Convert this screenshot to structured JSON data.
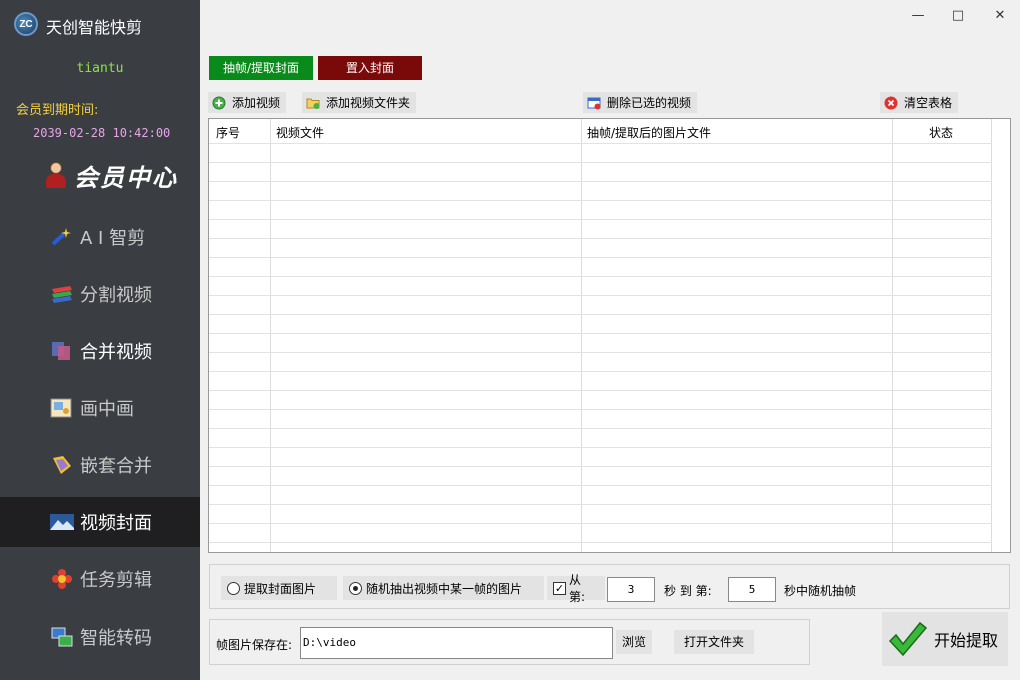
{
  "app": {
    "title": "天创智能快剪",
    "logo_text": "ZC"
  },
  "account": {
    "username": "tiantu",
    "expire_label": "会员到期时间:",
    "expire_value": "2039-02-28 10:42:00",
    "member_center": "会员中心"
  },
  "nav": {
    "ai": "A I 智剪",
    "split": "分割视频",
    "merge": "合并视频",
    "pip": "画中画",
    "nest": "嵌套合并",
    "cover": "视频封面",
    "task": "任务剪辑",
    "transcode": "智能转码"
  },
  "window": {
    "minimize": "—",
    "maximize": "□",
    "close": "✕"
  },
  "tabs": {
    "extract": "抽帧/提取封面",
    "insert": "置入封面"
  },
  "toolbar": {
    "add_video": "添加视频",
    "add_folder": "添加视频文件夹",
    "delete_selected": "删除已选的视频",
    "clear_table": "清空表格"
  },
  "table": {
    "columns": [
      "序号",
      "视频文件",
      "抽帧/提取后的图片文件",
      "状态"
    ]
  },
  "options": {
    "extract_cover": "提取封面图片",
    "random_frame": "随机抽出视频中某一帧的图片",
    "random_frame_selected": true,
    "range_checked": true,
    "from_label": "从第:",
    "from_value": "3",
    "sec_to": "秒 到 第:",
    "to_value": "5",
    "random_suffix": "秒中随机抽帧"
  },
  "save": {
    "label": "帧图片保存在:",
    "path": "D:\\video",
    "browse": "浏览",
    "open_folder": "打开文件夹"
  },
  "start": {
    "label": "开始提取"
  }
}
